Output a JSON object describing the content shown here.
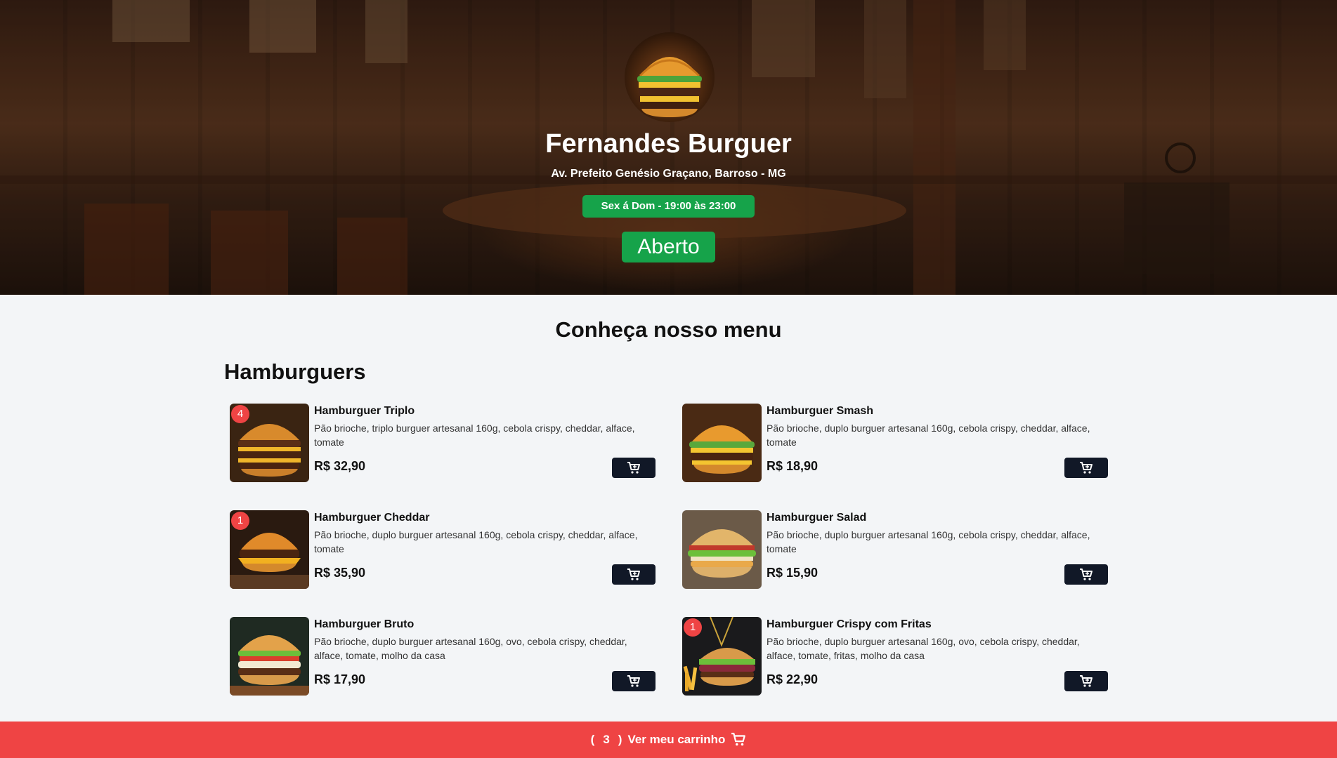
{
  "hero": {
    "title": "Fernandes Burguer",
    "address": "Av. Prefeito Genésio Graçano, Barroso - MG",
    "hours": "Sex á Dom - 19:00 às 23:00",
    "status": "Aberto"
  },
  "menu": {
    "heading": "Conheça nosso menu",
    "categories": [
      {
        "title": "Hamburguers",
        "items": [
          {
            "name": "Hamburguer Triplo",
            "description": "Pão brioche, triplo burguer artesanal 160g, cebola crispy, cheddar, alface, tomate",
            "price": "R$ 32,90",
            "quantity": "4"
          },
          {
            "name": "Hamburguer Smash",
            "description": "Pão brioche, duplo burguer artesanal 160g, cebola crispy, cheddar, alface, tomate",
            "price": "R$ 18,90",
            "quantity": ""
          },
          {
            "name": "Hamburguer Cheddar",
            "description": "Pão brioche, duplo burguer artesanal 160g, cebola crispy, cheddar, alface, tomate",
            "price": "R$ 35,90",
            "quantity": "1"
          },
          {
            "name": "Hamburguer Salad",
            "description": "Pão brioche, duplo burguer artesanal 160g, cebola crispy, cheddar, alface, tomate",
            "price": "R$ 15,90",
            "quantity": ""
          },
          {
            "name": "Hamburguer Bruto",
            "description": "Pão brioche, duplo burguer artesanal 160g, ovo, cebola crispy, cheddar, alface, tomate, molho da casa",
            "price": "R$ 17,90",
            "quantity": ""
          },
          {
            "name": "Hamburguer Crispy com Fritas",
            "description": "Pão brioche, duplo burguer artesanal 160g, ovo, cebola crispy, cheddar, alface, tomate, fritas, molho da casa",
            "price": "R$ 22,90",
            "quantity": "1"
          }
        ]
      }
    ]
  },
  "cart": {
    "open_paren": "(",
    "count": "3",
    "close_paren": ")",
    "label": "Ver meu carrinho",
    "icon": "cart-icon"
  },
  "icons": {
    "add_to_cart": "cart-plus-icon"
  },
  "colors": {
    "accent_green": "#16a34a",
    "cart_red": "#ef4444",
    "button_dark": "#111827",
    "background": "#f3f5f7"
  }
}
